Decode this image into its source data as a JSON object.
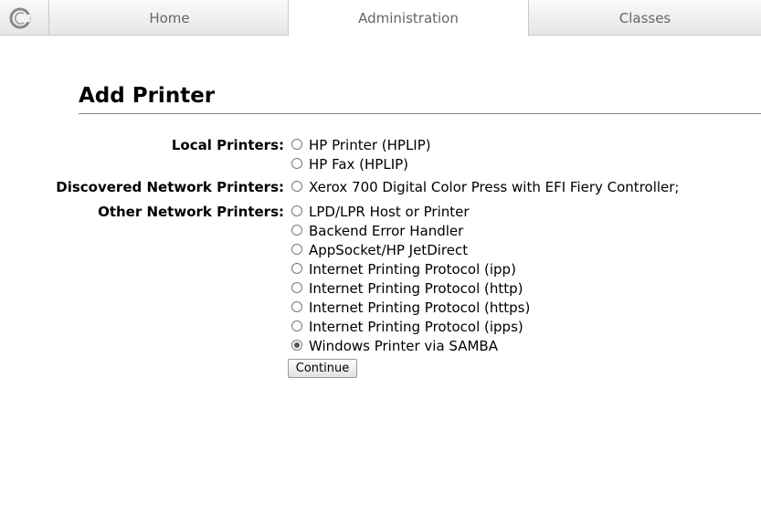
{
  "nav": {
    "tabs": [
      {
        "label": "Home"
      },
      {
        "label": "Administration"
      },
      {
        "label": "Classes"
      }
    ]
  },
  "page": {
    "title": "Add Printer"
  },
  "form": {
    "local_label": "Local Printers:",
    "discovered_label": "Discovered Network Printers:",
    "other_label": "Other Network Printers:",
    "local": [
      "HP Printer (HPLIP)",
      "HP Fax (HPLIP)"
    ],
    "discovered": [
      "Xerox 700 Digital Color Press with EFI Fiery Controller;"
    ],
    "other": [
      "LPD/LPR Host or Printer",
      "Backend Error Handler",
      "AppSocket/HP JetDirect",
      "Internet Printing Protocol (ipp)",
      "Internet Printing Protocol (http)",
      "Internet Printing Protocol (https)",
      "Internet Printing Protocol (ipps)",
      "Windows Printer via SAMBA"
    ],
    "selected": "Windows Printer via SAMBA",
    "continue_label": "Continue"
  }
}
